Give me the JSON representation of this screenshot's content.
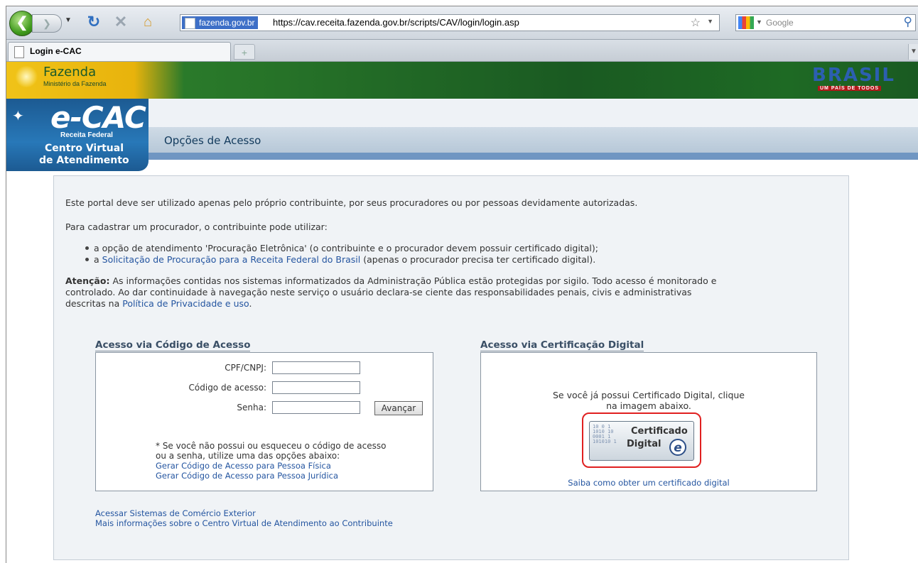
{
  "browser": {
    "url_domain": "fazenda.gov.br",
    "url": "https://cav.receita.fazenda.gov.br/scripts/CAV/login/login.asp",
    "search_placeholder": "Google",
    "tab_title": "Login e-CAC"
  },
  "header": {
    "ministry_name": "Fazenda",
    "ministry_sub": "Ministério da Fazenda",
    "brasil_logo": "BRASIL",
    "brasil_slogan": "UM PAÍS DE TODOS",
    "ecac_brand": "e-CAC",
    "ecac_org": "Receita Federal",
    "ecac_line1": "Centro Virtual",
    "ecac_line2": "de Atendimento",
    "page_title": "Opções de Acesso"
  },
  "intro": {
    "p1": "Este portal deve ser utilizado apenas pelo próprio contribuinte, por seus procuradores ou por pessoas devidamente autorizadas.",
    "p2": "Para cadastrar um procurador, o contribuinte pode utilizar:",
    "bullet1": "a opção de atendimento 'Procuração Eletrônica' (o contribuinte e o procurador devem possuir certificado digital);",
    "bullet2_prefix": "a ",
    "bullet2_link": "Solicitação de Procuração para a Receita Federal do Brasil",
    "bullet2_suffix": " (apenas o procurador precisa ter certificado digital).",
    "attention_label": "Atenção:",
    "attention_line1": " As informações contidas nos sistemas informatizados da Administração Pública estão protegidas por sigilo. Todo acesso é monitorado e",
    "attention_line2": "controlado. Ao dar continuidade à navegação neste serviço o usuário declara-se ciente das responsabilidades penais, civis e administrativas",
    "attention_line3_prefix": "descritas na ",
    "attention_link": "Política de Privacidade e uso",
    "attention_line3_suffix": "."
  },
  "code_access": {
    "title": "Acesso via Código de Acesso",
    "cpf_label": "CPF/CNPJ:",
    "code_label": "Código de acesso:",
    "password_label": "Senha:",
    "submit_label": "Avançar",
    "note_line1": "* Se você não possui ou esqueceu o código de acesso",
    "note_line2": "ou a senha, utilize uma das opções abaixo:",
    "link_pf": "Gerar Código de Acesso para Pessoa Física",
    "link_pj": "Gerar Código de Acesso para Pessoa Jurídica"
  },
  "cert_access": {
    "title": "Acesso via Certificação Digital",
    "text_line1": "Se você já possui Certificado Digital, clique",
    "text_line2": "na imagem abaixo.",
    "button_line1": "Certificado",
    "button_line2": "Digital",
    "button_e": "e",
    "link": "Saiba como obter um certificado digital"
  },
  "footer_links": {
    "comex": "Acessar Sistemas de Comércio Exterior",
    "more_info": "Mais informações sobre o Centro Virtual de Atendimento ao Contribuinte"
  }
}
